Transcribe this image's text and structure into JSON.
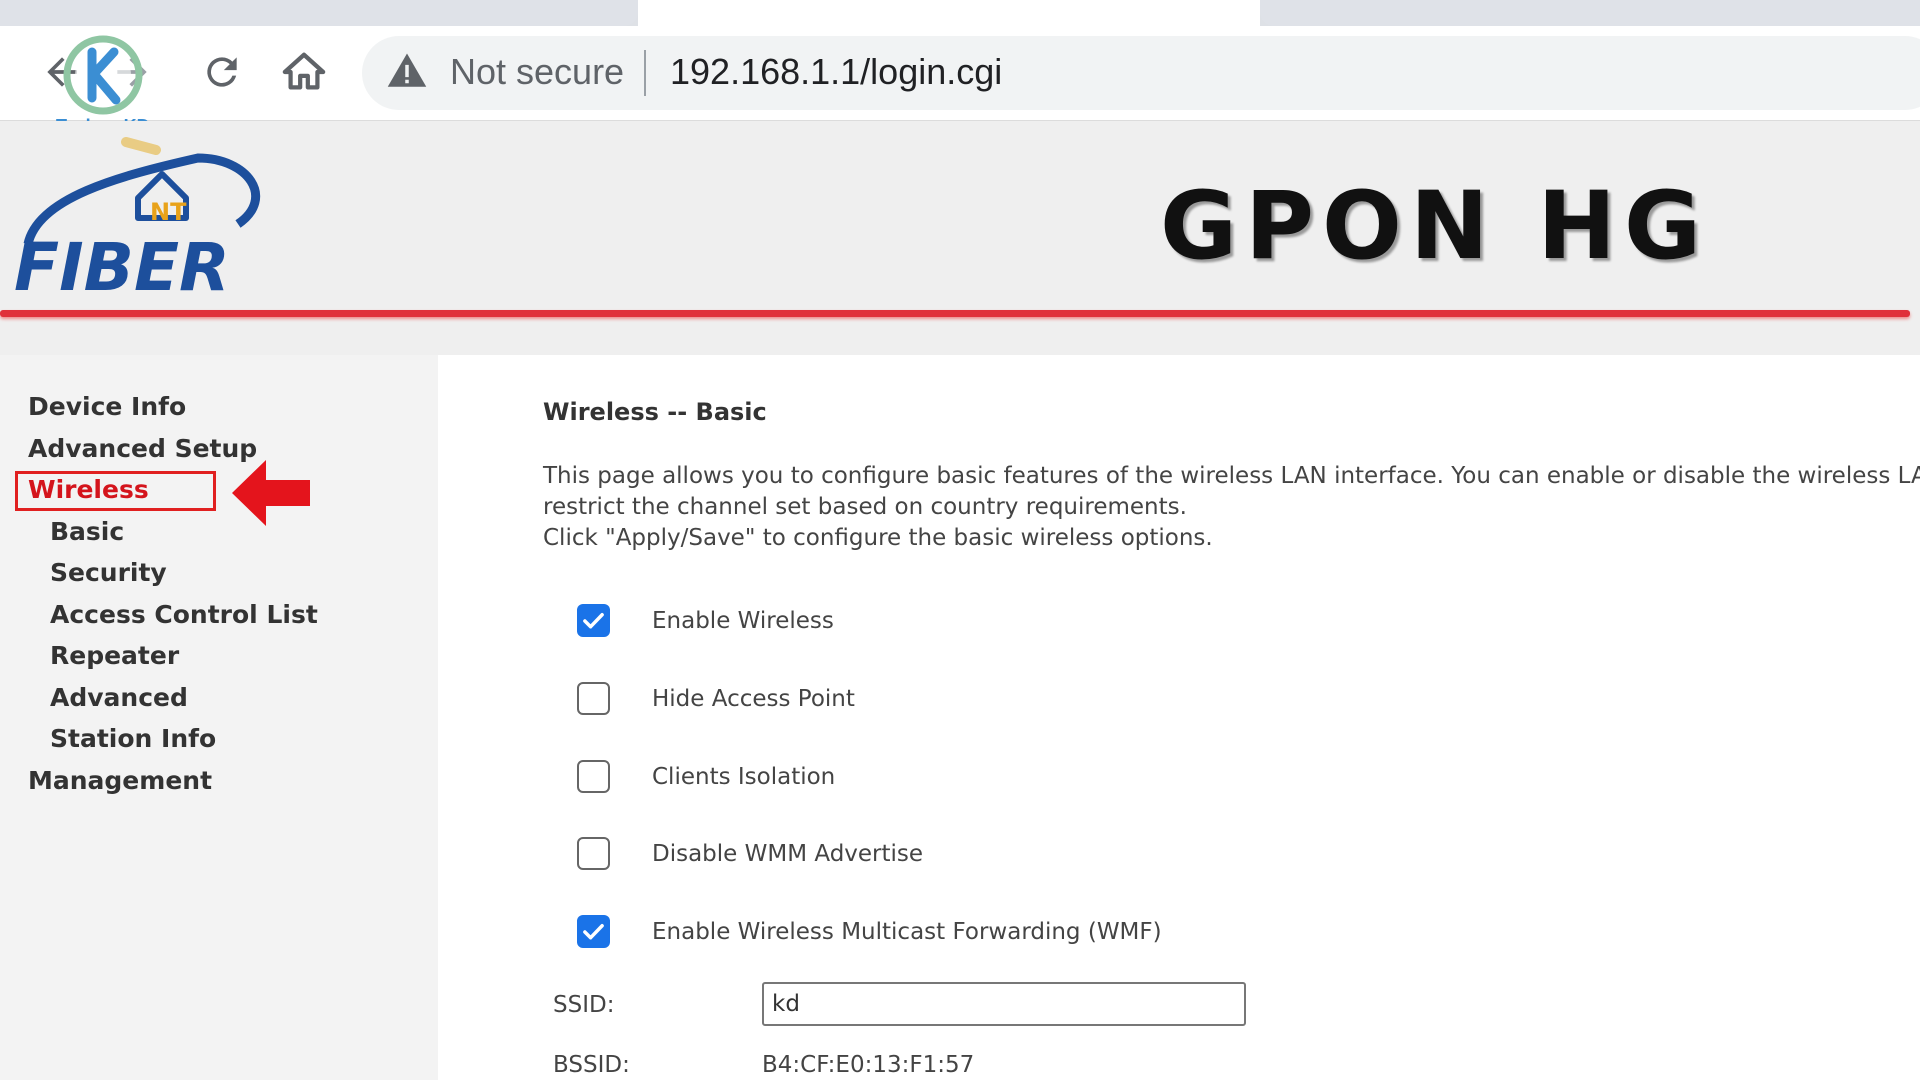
{
  "browser": {
    "nav": {
      "back_icon": "arrow-left-icon",
      "forward_icon": "arrow-right-icon",
      "reload_icon": "reload-icon",
      "home_icon": "home-icon"
    },
    "security_status": "Not secure",
    "url": "192.168.1.1/login.cgi"
  },
  "watermark": {
    "text": "Techno KD"
  },
  "banner": {
    "logo_text": "FIBER",
    "logo_badge": "NT",
    "title": "GPON HG"
  },
  "sidebar": {
    "items": [
      {
        "label": "Device Info",
        "level": 0,
        "active": false
      },
      {
        "label": "Advanced Setup",
        "level": 0,
        "active": false
      },
      {
        "label": "Wireless",
        "level": 0,
        "active": true
      },
      {
        "label": "Basic",
        "level": 1,
        "active": false
      },
      {
        "label": "Security",
        "level": 1,
        "active": false
      },
      {
        "label": "Access Control List",
        "level": 1,
        "active": false
      },
      {
        "label": "Repeater",
        "level": 1,
        "active": false
      },
      {
        "label": "Advanced",
        "level": 1,
        "active": false
      },
      {
        "label": "Station Info",
        "level": 1,
        "active": false
      },
      {
        "label": "Management",
        "level": 0,
        "active": false
      }
    ]
  },
  "main": {
    "title": "Wireless -- Basic",
    "description": [
      "This page allows you to configure basic features of the wireless LAN interface. You can enable or disable the wireless LA",
      "restrict the channel set based on country requirements.",
      "Click \"Apply/Save\" to configure the basic wireless options."
    ],
    "options": [
      {
        "label": "Enable Wireless",
        "checked": true
      },
      {
        "label": "Hide Access Point",
        "checked": false
      },
      {
        "label": "Clients Isolation",
        "checked": false
      },
      {
        "label": "Disable WMM Advertise",
        "checked": false
      },
      {
        "label": "Enable Wireless Multicast Forwarding (WMF)",
        "checked": true
      }
    ],
    "ssid": {
      "label": "SSID:",
      "value": "kd"
    },
    "bssid": {
      "label": "BSSID:",
      "value": "B4:CF:E0:13:F1:57"
    }
  },
  "colors": {
    "accent_red": "#e0303a",
    "checkbox_blue": "#1a73e8",
    "active_menu": "#d4141c",
    "logo_blue": "#1d4f9c"
  }
}
